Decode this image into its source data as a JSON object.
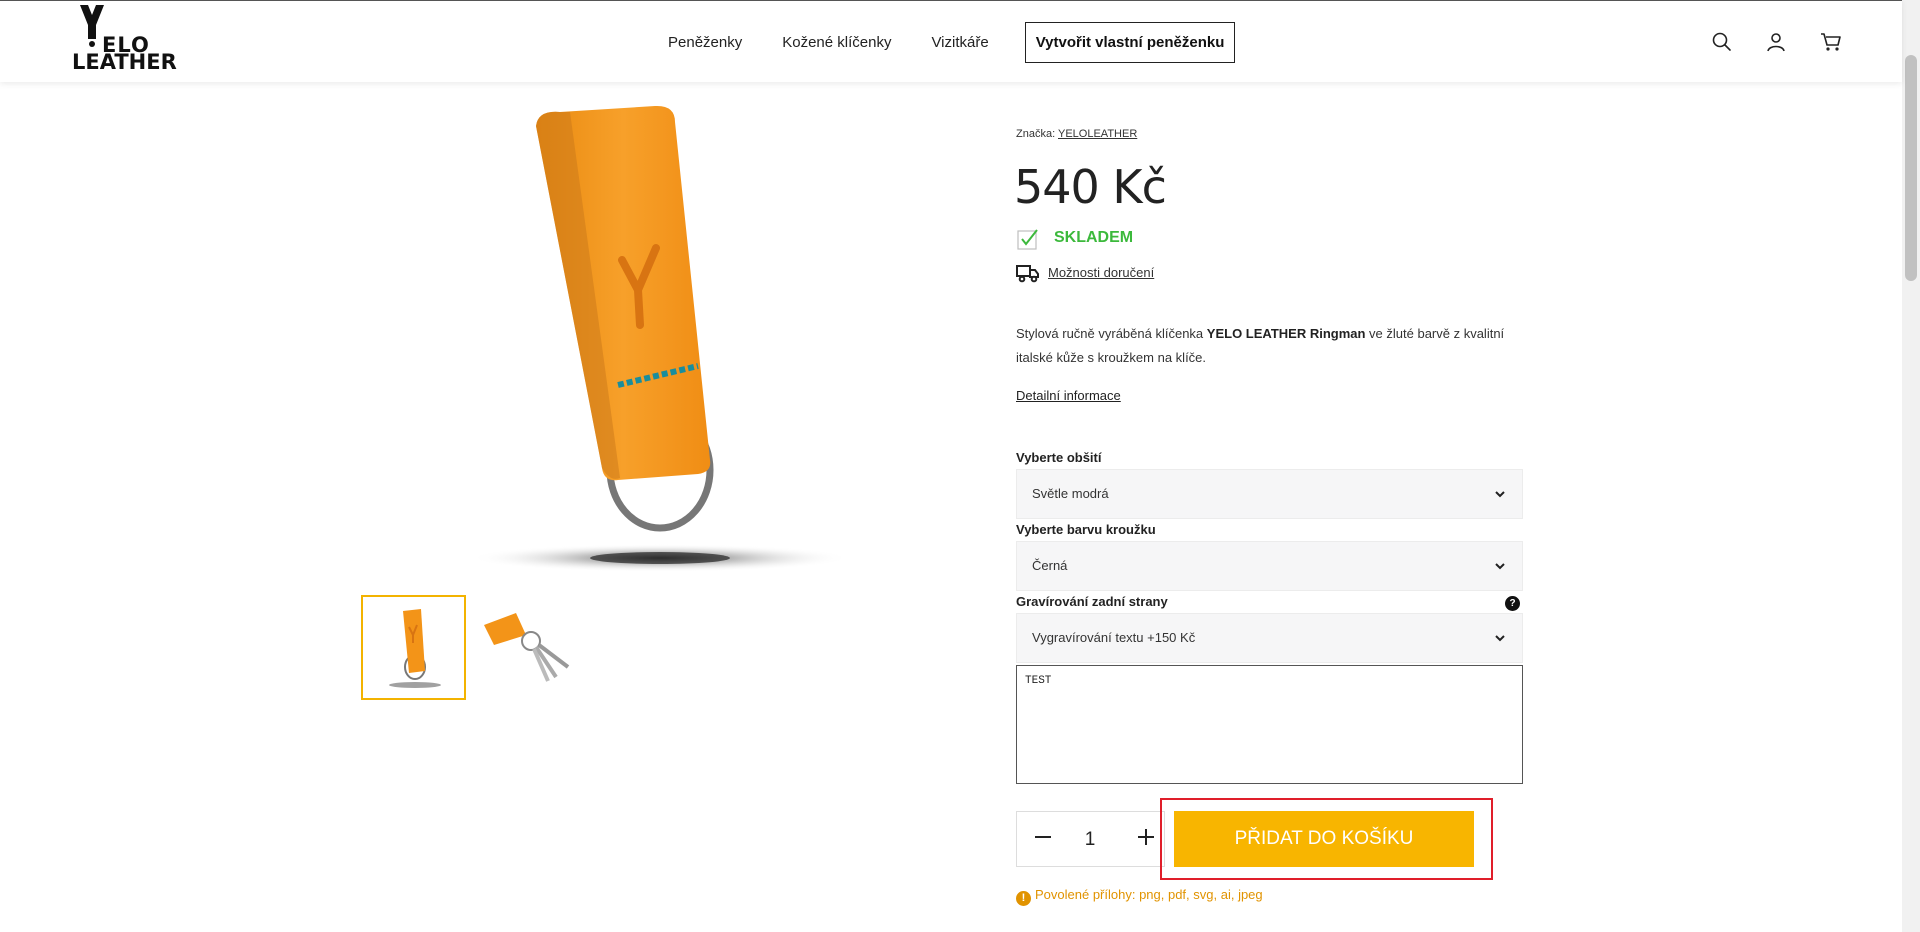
{
  "header": {
    "logo_line1": "ELO",
    "logo_line2": "LEATHER",
    "nav": [
      "Peněženky",
      "Kožené klíčenky",
      "Vizitkáře"
    ],
    "cta": "Vytvořit vlastní peněženku"
  },
  "product": {
    "brand_label": "Značka:",
    "brand_name": "YELOLEATHER",
    "price": "540 Kč",
    "stock": "SKLADEM",
    "delivery": "Možnosti doručení",
    "desc_pre": "Stylová ručně vyráběná klíčenka ",
    "desc_bold": "YELO LEATHER Ringman",
    "desc_post": " ve žluté barvě z kvalitní italské kůže s kroužkem na klíče.",
    "detail_link": "Detailní informace"
  },
  "options": {
    "stitching_label": "Vyberte obšití",
    "stitching_value": "Světle modrá",
    "ring_label": "Vyberte barvu kroužku",
    "ring_value": "Černá",
    "engraving_label": "Gravírování zadní strany",
    "engraving_value": "Vygravírování textu +150 Kč",
    "engraving_text": "TEST",
    "help": "?"
  },
  "cart": {
    "quantity": "1",
    "add_label": "PŘIDAT DO KOŠÍKU",
    "attachments": "Povolené přílohy: png, pdf, svg, ai, jpeg",
    "warn_glyph": "!"
  },
  "colors": {
    "accent": "#f8b500",
    "stock_green": "#3cb93c",
    "warning": "#e19300",
    "highlight": "#e01e2a",
    "leather": "#f39418"
  }
}
